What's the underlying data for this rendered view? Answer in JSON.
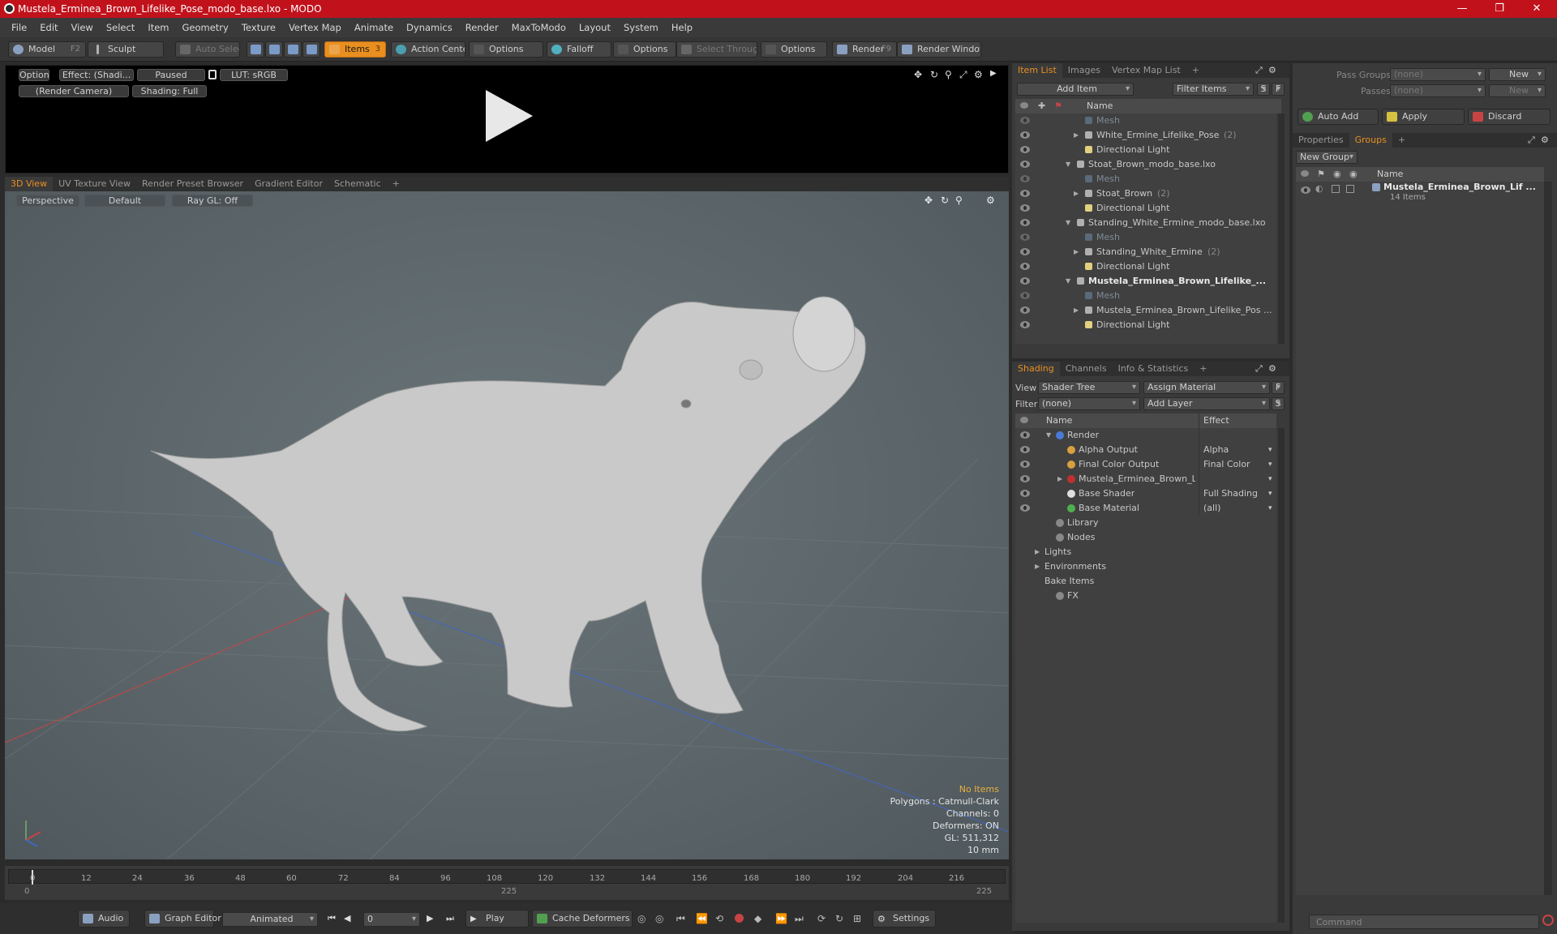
{
  "window": {
    "title": "Mustela_Erminea_Brown_Lifelike_Pose_modo_base.lxo - MODO",
    "minimize": "—",
    "maximize": "❐",
    "close": "✕"
  },
  "menu": [
    "File",
    "Edit",
    "View",
    "Select",
    "Item",
    "Geometry",
    "Texture",
    "Vertex Map",
    "Animate",
    "Dynamics",
    "Render",
    "MaxToModo",
    "Layout",
    "System",
    "Help"
  ],
  "toolbar": {
    "model": "Model",
    "model_key": "F2",
    "sculpt": "Sculpt",
    "auto_select": "Auto Select",
    "items": "Items",
    "items_key": "3",
    "action_center": "Action Center",
    "options1": "Options",
    "falloff": "Falloff",
    "options2": "Options",
    "select_through": "Select Through",
    "options3": "Options",
    "render": "Render",
    "render_key": "F9",
    "render_window": "Render Window"
  },
  "preview": {
    "options": "Options",
    "effect": "Effect: (Shadi...",
    "paused": "Paused",
    "lut": "LUT: sRGB",
    "camera": "(Render Camera)",
    "shading": "Shading: Full"
  },
  "viewport_tabs": [
    "3D View",
    "UV Texture View",
    "Render Preset Browser",
    "Gradient Editor",
    "Schematic",
    "+"
  ],
  "viewport": {
    "perspective": "Perspective",
    "default": "Default",
    "raygl": "Ray GL: Off",
    "stats": {
      "no_items": "No Items",
      "polygons": "Polygons : Catmull-Clark",
      "channels": "Channels: 0",
      "deformers": "Deformers: ON",
      "gl": "GL: 511,312",
      "scale": "10 mm"
    }
  },
  "timeline": {
    "ticks": [
      "0",
      "12",
      "24",
      "36",
      "48",
      "60",
      "72",
      "84",
      "96",
      "108",
      "120",
      "132",
      "144",
      "156",
      "168",
      "180",
      "192",
      "204",
      "216"
    ],
    "start": "0",
    "mid": "225",
    "end": "225"
  },
  "bottom": {
    "audio": "Audio",
    "graph_editor": "Graph Editor",
    "animated": "Animated",
    "frame": "0",
    "play": "Play",
    "cache_deformers": "Cache Deformers",
    "settings": "Settings"
  },
  "item_list": {
    "tabs": [
      "Item List",
      "Images",
      "Vertex Map List",
      "+"
    ],
    "add_item": "Add Item",
    "filter_items": "Filter Items",
    "s": "S",
    "f": "F",
    "name_col": "Name",
    "rows": [
      {
        "label": "Mesh",
        "style": "grey",
        "indent": 3
      },
      {
        "label": "White_Ermine_Lifelike_Pose",
        "count": "(2)",
        "style": "normal",
        "indent": 3,
        "arrow": "▶"
      },
      {
        "label": "Directional Light",
        "style": "normal",
        "indent": 3
      },
      {
        "label": "Stoat_Brown_modo_base.lxo",
        "style": "normal",
        "indent": 2,
        "arrow": "▼"
      },
      {
        "label": "Mesh",
        "style": "grey",
        "indent": 3
      },
      {
        "label": "Stoat_Brown",
        "count": "(2)",
        "style": "normal",
        "indent": 3,
        "arrow": "▶"
      },
      {
        "label": "Directional Light",
        "style": "normal",
        "indent": 3
      },
      {
        "label": "Standing_White_Ermine_modo_base.lxo",
        "style": "normal",
        "indent": 2,
        "arrow": "▼"
      },
      {
        "label": "Mesh",
        "style": "grey",
        "indent": 3
      },
      {
        "label": "Standing_White_Ermine",
        "count": "(2)",
        "style": "normal",
        "indent": 3,
        "arrow": "▶"
      },
      {
        "label": "Directional Light",
        "style": "normal",
        "indent": 3
      },
      {
        "label": "Mustela_Erminea_Brown_Lifelike_...",
        "style": "bold",
        "indent": 2,
        "arrow": "▼"
      },
      {
        "label": "Mesh",
        "style": "grey",
        "indent": 3
      },
      {
        "label": "Mustela_Erminea_Brown_Lifelike_Pos ...",
        "style": "normal",
        "indent": 3,
        "arrow": "▶"
      },
      {
        "label": "Directional Light",
        "style": "normal",
        "indent": 3
      }
    ]
  },
  "shading": {
    "tabs": [
      "Shading",
      "Channels",
      "Info & Statistics",
      "+"
    ],
    "view_label": "View",
    "view_value": "Shader Tree",
    "assign_material": "Assign Material",
    "filter_label": "Filter",
    "filter_value": "(none)",
    "add_layer": "Add Layer",
    "f": "F",
    "s": "S",
    "name_col": "Name",
    "effect_col": "Effect",
    "rows": [
      {
        "label": "Render",
        "effect": "",
        "indent": 1,
        "arrow": "▼",
        "icon": "#4a7ad8"
      },
      {
        "label": "Alpha Output",
        "effect": "Alpha",
        "indent": 2,
        "icon": "#d8a040"
      },
      {
        "label": "Final Color Output",
        "effect": "Final Color",
        "indent": 2,
        "icon": "#d8a040"
      },
      {
        "label": "Mustela_Erminea_Brown_L...",
        "effect": "",
        "indent": 2,
        "arrow": "▶",
        "icon": "#c03030"
      },
      {
        "label": "Base Shader",
        "effect": "Full Shading",
        "indent": 2,
        "icon": "#e0e0e0"
      },
      {
        "label": "Base Material",
        "effect": "(all)",
        "indent": 2,
        "icon": "#50b050"
      },
      {
        "label": "Library",
        "effect": "",
        "indent": 1,
        "icon": "#888888"
      },
      {
        "label": "Nodes",
        "effect": "",
        "indent": 1,
        "icon": "#888888"
      },
      {
        "label": "Lights",
        "effect": "",
        "indent": 0,
        "arrow": "▶"
      },
      {
        "label": "Environments",
        "effect": "",
        "indent": 0,
        "arrow": "▶"
      },
      {
        "label": "Bake Items",
        "effect": "",
        "indent": 0
      },
      {
        "label": "FX",
        "effect": "",
        "indent": 1,
        "icon": "#888888"
      }
    ]
  },
  "groups_panel": {
    "pass_groups_label": "Pass Groups",
    "pass_groups_value": "(none)",
    "new1": "New",
    "passes_label": "Passes",
    "passes_value": "(none)",
    "new2": "New",
    "auto_add": "Auto Add",
    "apply": "Apply",
    "discard": "Discard",
    "tabs": [
      "Properties",
      "Groups",
      "+"
    ],
    "new_group": "New Group",
    "name_col": "Name",
    "group_name": "Mustela_Erminea_Brown_Lif ...",
    "group_count": "14 Items",
    "command_placeholder": "Command"
  },
  "colors": {
    "accent": "#e88f20",
    "titlebar": "#c1121c"
  }
}
